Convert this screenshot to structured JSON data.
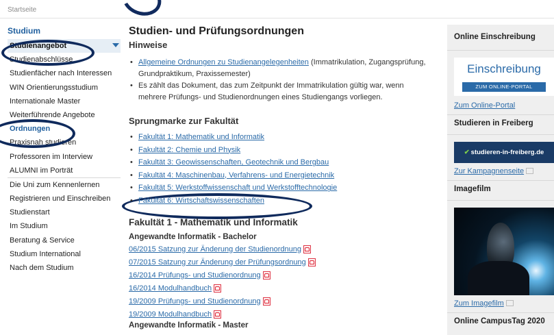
{
  "breadcrumb": "Startseite",
  "sidebar": {
    "heading": "Studium",
    "items": [
      "Studienangebot",
      "Studienabschlüsse",
      "Studienfächer nach Interessen",
      "WIN Orientierungsstudium",
      "Internationale Master",
      "Weiterführende Angebote",
      "Ordnungen",
      "Praxisnah studieren",
      "Professoren im Interview",
      "ALUMNI im Porträt",
      "Die Uni zum Kennenlernen",
      "Registrieren und Einschreiben",
      "Studienstart",
      "Im Studium",
      "Beratung & Service",
      "Studium International",
      "Nach dem Studium"
    ]
  },
  "main": {
    "title": "Studien- und Prüfungsordnungen",
    "hinweise_heading": "Hinweise",
    "hinweise": {
      "link": "Allgemeine Ordnungen zu Studienangelegenheiten",
      "link_suffix": " (Immatrikulation, Zugangsprüfung, Grundpraktikum, Praxissemester)",
      "note": "Es zählt das Dokument, das zum Zeitpunkt der Immatrikulation gültig war, wenn mehrere Prüfungs- und Studienordnungen eines Studiengangs vorliegen."
    },
    "sprung_heading": "Sprungmarke zur Fakultät",
    "faculties": [
      "Fakultät 1: Mathematik und Informatik",
      "Fakultät 2: Chemie und Physik",
      "Fakultät 3: Geowissenschaften, Geotechnik und Bergbau",
      "Fakultät 4: Maschinenbau, Verfahrens- und Energietechnik",
      "Fakultät 5: Werkstoffwissenschaft und Werkstofftechnologie",
      "Fakultät 6: Wirtschaftswissenschaften"
    ],
    "fac1_heading": "Fakultät 1 - Mathematik und Informatik",
    "program1": "Angewandte Informatik - Bachelor",
    "docs": [
      "06/2015 Satzung zur Änderung der Studienordnung",
      "07/2015 Satzung zur Änderung der Prüfungsordnung",
      "16/2014 Prüfungs- und Studienordnung",
      "16/2014 Modulhandbuch",
      "19/2009 Prüfungs- und Studienordnung",
      "19/2009 Modulhandbuch"
    ],
    "program2": "Angewandte Informatik - Master"
  },
  "right": {
    "einschreibung_heading": "Online Einschreibung",
    "banner1_big": "Einschreibung",
    "banner1_small": "ZUM ONLINE-PORTAL",
    "portal_link": "Zum Online-Portal",
    "freiberg_heading": "Studieren in Freiberg",
    "banner2": "studieren-in-freiberg.de",
    "kampagne_link": "Zur Kampagnenseite",
    "imagefilm_heading": "Imagefilm",
    "imagefilm_link": "Zum Imagefilm",
    "campustag_heading": "Online CampusTag 2020"
  },
  "colors": {
    "link": "#2a6aa8",
    "annotation": "#0f2a5c",
    "active_bg": "#e6eef5"
  }
}
